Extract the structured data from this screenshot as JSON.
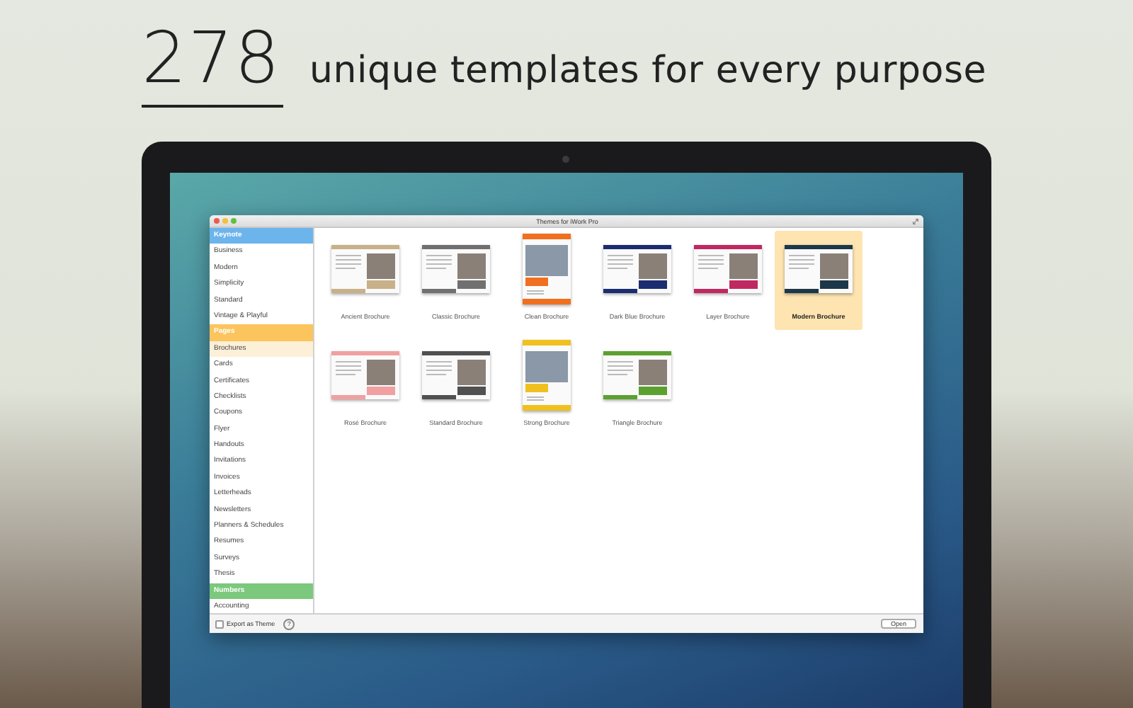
{
  "headline": {
    "number": "278",
    "text": "unique templates for every purpose"
  },
  "window": {
    "title": "Themes for iWork Pro"
  },
  "sidebar": {
    "groups": [
      {
        "label": "Keynote",
        "color": "#6cb4ec",
        "selected": false,
        "items": [
          {
            "label": "Business",
            "selected": false
          },
          {
            "label": "Modern",
            "selected": false
          },
          {
            "label": "Simplicity",
            "selected": false
          },
          {
            "label": "Standard",
            "selected": false
          },
          {
            "label": "Vintage & Playful",
            "selected": false
          }
        ]
      },
      {
        "label": "Pages",
        "color": "#fcc45c",
        "selected": false,
        "items": [
          {
            "label": "Brochures",
            "selected": true
          },
          {
            "label": "Cards",
            "selected": false
          },
          {
            "label": "Certificates",
            "selected": false
          },
          {
            "label": "Checklists",
            "selected": false
          },
          {
            "label": "Coupons",
            "selected": false
          },
          {
            "label": "Flyer",
            "selected": false
          },
          {
            "label": "Handouts",
            "selected": false
          },
          {
            "label": "Invitations",
            "selected": false
          },
          {
            "label": "Invoices",
            "selected": false
          },
          {
            "label": "Letterheads",
            "selected": false
          },
          {
            "label": "Newsletters",
            "selected": false
          },
          {
            "label": "Planners & Schedules",
            "selected": false
          },
          {
            "label": "Resumes",
            "selected": false
          },
          {
            "label": "Surveys",
            "selected": false
          },
          {
            "label": "Thesis",
            "selected": false
          }
        ]
      },
      {
        "label": "Numbers",
        "color": "#7cc87c",
        "selected": false,
        "items": [
          {
            "label": "Accounting",
            "selected": false
          }
        ]
      }
    ]
  },
  "templates": [
    {
      "label": "Ancient Brochure",
      "kind": "landscape",
      "color": "#c8b088",
      "selected": false
    },
    {
      "label": "Classic Brochure",
      "kind": "landscape",
      "color": "#707070",
      "selected": false
    },
    {
      "label": "Clean Brochure",
      "kind": "portrait",
      "color": "#f07020",
      "selected": false
    },
    {
      "label": "Dark Blue Brochure",
      "kind": "landscape",
      "color": "#1c2c70",
      "selected": false
    },
    {
      "label": "Layer Brochure",
      "kind": "landscape",
      "color": "#c02860",
      "selected": false
    },
    {
      "label": "Modern Brochure",
      "kind": "landscape",
      "color": "#1c3848",
      "selected": true
    },
    {
      "label": "Rosé Brochure",
      "kind": "landscape",
      "color": "#f0a0a0",
      "selected": false
    },
    {
      "label": "Standard Brochure",
      "kind": "landscape",
      "color": "#505050",
      "selected": false
    },
    {
      "label": "Strong Brochure",
      "kind": "portrait",
      "color": "#f0c020",
      "selected": false
    },
    {
      "label": "Triangle Brochure",
      "kind": "landscape",
      "color": "#5ca030",
      "selected": false
    }
  ],
  "footer": {
    "export_label": "Export as Theme",
    "export_checked": false,
    "help": "?",
    "open_button": "Open"
  }
}
